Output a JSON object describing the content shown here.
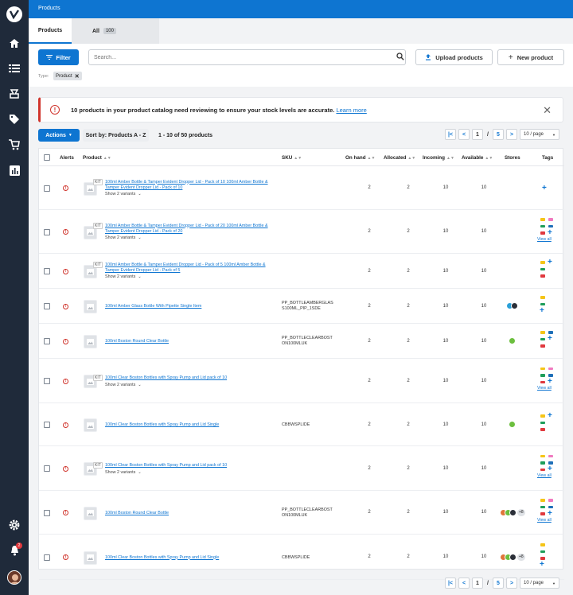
{
  "app": {
    "title": "Products"
  },
  "sidebar": {
    "items": [
      "home-icon",
      "list-icon",
      "inventory-icon",
      "tag-icon",
      "cart-icon",
      "reports-icon"
    ],
    "bottom": [
      "settings-icon",
      "bell-icon",
      "avatar"
    ],
    "notification_count": "2"
  },
  "tabs": [
    {
      "label": "Products"
    },
    {
      "label": "All",
      "count": "100"
    }
  ],
  "toolbar": {
    "filter_label": "Filter",
    "search_placeholder": "Search...",
    "upload_label": "Upload products",
    "new_label": "New product",
    "type_label": "Type:",
    "type_chip": "Product"
  },
  "banner": {
    "text": "10 products in your product catalog need reviewing to ensure your stock levels are accurate.",
    "link": "Learn more"
  },
  "list_controls": {
    "actions_label": "Actions",
    "sort_label": "Sort by: Products A - Z",
    "range_text": "1 - 10 of 50 products",
    "page": "1",
    "sep": "/",
    "total_pages": "5",
    "per_page": "10 / page"
  },
  "table": {
    "headers": {
      "alerts": "Alerts",
      "product": "Product",
      "sku": "SKU",
      "on_hand": "On hand",
      "allocated": "Allocated",
      "incoming": "Incoming",
      "available": "Available",
      "stores": "Stores",
      "tags": "Tags"
    },
    "kit_label": "KIT",
    "variants_label": "Show 2 variants",
    "view_all": "View all",
    "more_stores": "+8",
    "rows": [
      {
        "name": "100ml Amber Bottle & Tamper Evident Dropper Lid - Pack of 10 100ml Amber Bottle & Tamper Evident Dropper Lid - Pack of 10",
        "kit": true,
        "variants": true,
        "sku": "",
        "on_hand": "2",
        "allocated": "2",
        "incoming": "10",
        "available": "10"
      },
      {
        "name": "100ml Amber Bottle & Tamper Evident Dropper Lid - Pack of 20 100ml Amber Bottle & Tamper Evident Dropper Lid - Pack of 20",
        "kit": true,
        "variants": true,
        "sku": "",
        "on_hand": "2",
        "allocated": "2",
        "incoming": "10",
        "available": "10"
      },
      {
        "name": "100ml Amber Bottle & Tamper Evident Dropper Lid - Pack of 5 100ml Amber Bottle & Tamper Evident Dropper Lid - Pack of 5",
        "kit": true,
        "variants": true,
        "sku": "",
        "on_hand": "2",
        "allocated": "2",
        "incoming": "10",
        "available": "10"
      },
      {
        "name": "100ml Amber Glass Bottle With Pipette Single Item",
        "kit": false,
        "variants": false,
        "sku": "PP_BOTTLEAMBERGLASS100ML_PIP_1SDE",
        "sku_l1": "PP_BOTTLEAMBERGLAS",
        "sku_l2": "S100ML_PIP_1SDE",
        "on_hand": "2",
        "allocated": "2",
        "incoming": "10",
        "available": "10"
      },
      {
        "name": "100ml Boston Round Clear Bottle",
        "kit": false,
        "variants": false,
        "sku": "PP_BOTTLECLEARBOSTON100MLUK",
        "sku_l1": "PP_BOTTLECLEARBOST",
        "sku_l2": "ON100MLUK",
        "on_hand": "2",
        "allocated": "2",
        "incoming": "10",
        "available": "10"
      },
      {
        "name": "100ml Clear Boston Bottles with Spray Pump and Lid pack of 10",
        "kit": true,
        "variants": true,
        "sku": "",
        "on_hand": "2",
        "allocated": "2",
        "incoming": "10",
        "available": "10"
      },
      {
        "name": "100ml Clear Boston Bottles with Spray Pump and Lid Single",
        "kit": false,
        "variants": false,
        "sku": "CBBWSPLIDE",
        "on_hand": "2",
        "allocated": "2",
        "incoming": "10",
        "available": "10"
      },
      {
        "name": "100ml Clear Boston Bottles with Spray Pump and Lid pack of 10",
        "kit": true,
        "variants": true,
        "sku": "",
        "on_hand": "2",
        "allocated": "2",
        "incoming": "10",
        "available": "10"
      },
      {
        "name": "100ml Boston Round Clear Bottle",
        "kit": false,
        "variants": false,
        "sku": "PP_BOTTLECLEARBOSTON100MLUK",
        "sku_l1": "PP_BOTTLECLEARBOST",
        "sku_l2": "ON100MLUK",
        "on_hand": "2",
        "allocated": "2",
        "incoming": "10",
        "available": "10"
      },
      {
        "name": "100ml Clear Boston Bottles with Spray Pump and Lid Single",
        "kit": false,
        "variants": false,
        "sku": "CBBWSPLIDE",
        "on_hand": "2",
        "allocated": "2",
        "incoming": "10",
        "available": "10"
      }
    ]
  },
  "colors": {
    "primary": "#0e75d1",
    "sidebar": "#1f2a3a",
    "alert": "#d0342c",
    "tag_yellow": "#f5c518",
    "tag_green": "#1e9e5a",
    "tag_red": "#e0393e",
    "tag_pink": "#f07ac0",
    "tag_blue": "#1f6fb8"
  }
}
